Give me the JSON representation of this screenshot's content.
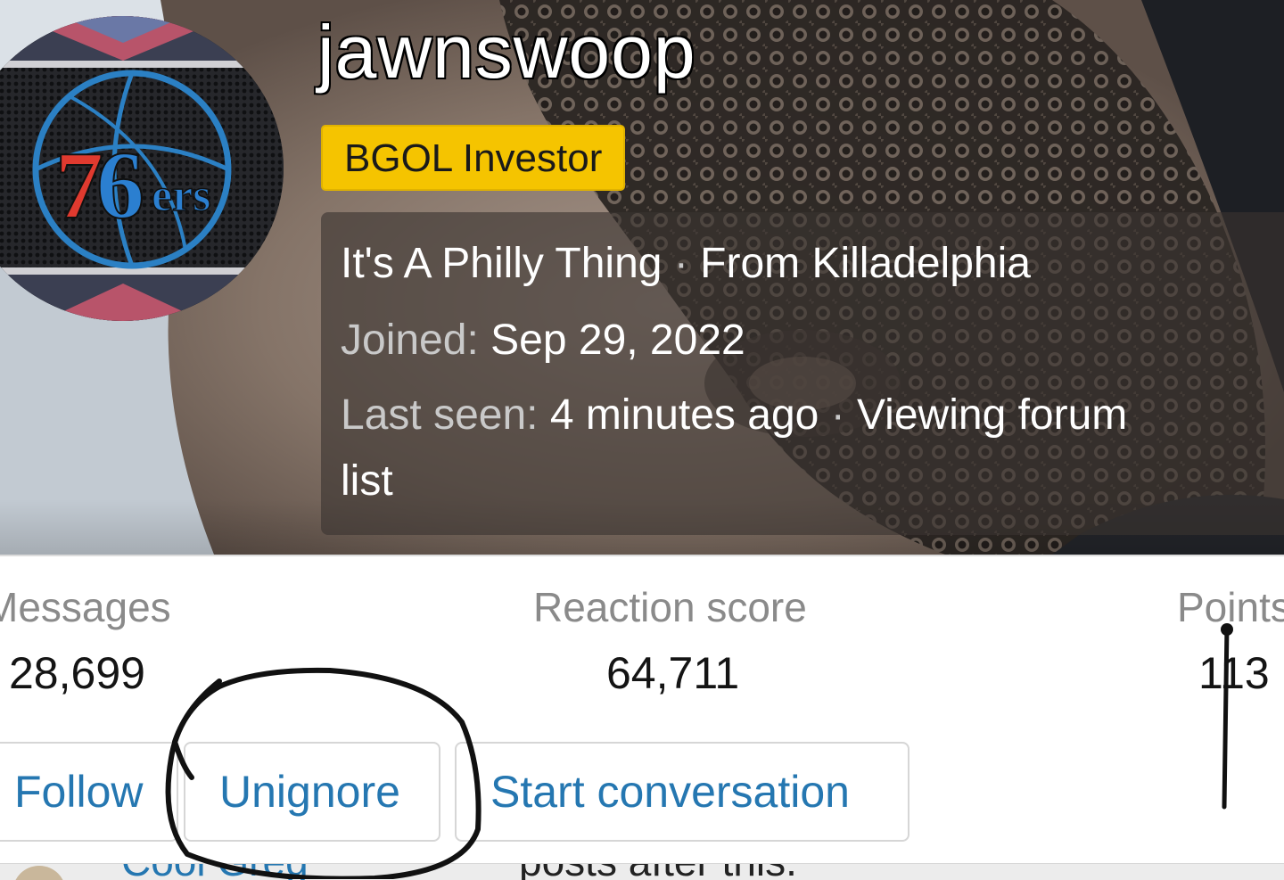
{
  "profile": {
    "username": "jawnswoop",
    "user_title": "BGOL Investor",
    "custom_title": "It's A Philly Thing",
    "separator": "·",
    "location_label": "From Killadelphia",
    "joined_label": "Joined:",
    "joined_date": "Sep 29, 2022",
    "last_seen_label": "Last seen:",
    "last_seen_value": "4 minutes ago",
    "activity": "Viewing forum list",
    "activity_line1": "Viewing forum",
    "activity_line2": "list"
  },
  "avatar": {
    "logo_text": "76ers",
    "icon": "76ers-logo"
  },
  "stats": [
    {
      "label": "Messages",
      "value": "28,699"
    },
    {
      "label": "Reaction score",
      "value": "64,711"
    },
    {
      "label": "Points",
      "value": "113"
    }
  ],
  "actions": {
    "follow": "Follow",
    "unignore": "Unignore",
    "start_conversation": "Start conversation"
  },
  "below_fold": {
    "member_name_partial": "Cool Greg",
    "post_partial": "posts after this."
  },
  "colors": {
    "accent": "#2577b1",
    "badge": "#f5c400",
    "label_gray": "#8a8a8a"
  }
}
